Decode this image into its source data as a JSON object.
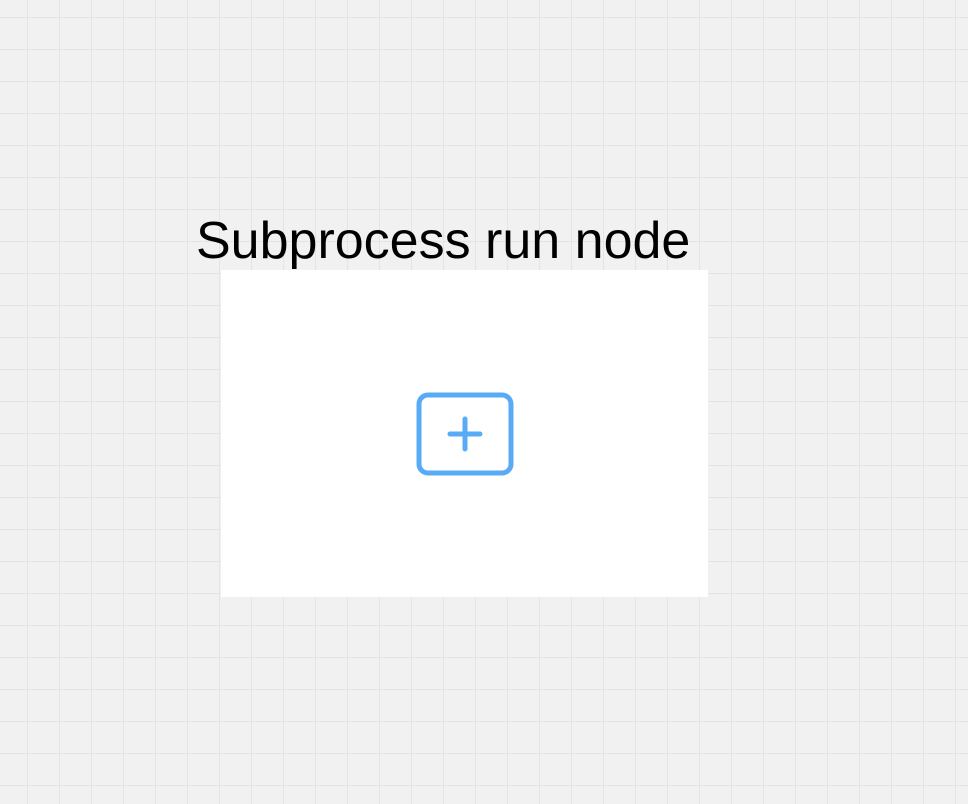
{
  "node": {
    "title": "Subprocess run node",
    "expand_icon": "plus-square-icon",
    "accent_color": "#5aabf5"
  },
  "canvas": {
    "background_color": "#f1f1f1",
    "grid_line_color": "#e4e4e4"
  }
}
